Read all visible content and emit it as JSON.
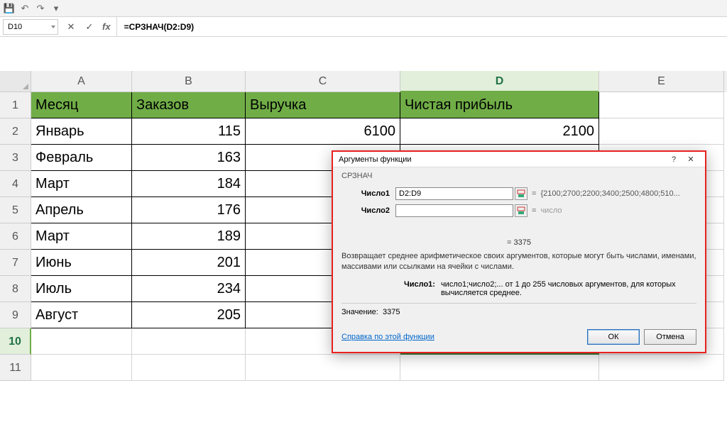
{
  "qat": {
    "save": "💾",
    "undo": "↶",
    "redo": "↷"
  },
  "nameBox": "D10",
  "formulaBar": "=СРЗНАЧ(D2:D9)",
  "columns": [
    "A",
    "B",
    "C",
    "D",
    "E"
  ],
  "rows": [
    "1",
    "2",
    "3",
    "4",
    "5",
    "6",
    "7",
    "8",
    "9",
    "10",
    "11"
  ],
  "headers": {
    "A": "Месяц",
    "B": "Заказов",
    "C": "Выручка",
    "D": "Чистая прибыль"
  },
  "data": [
    {
      "A": "Январь",
      "B": "115",
      "C": "6100",
      "D": "2100"
    },
    {
      "A": "Февраль",
      "B": "163",
      "C": "",
      "D": ""
    },
    {
      "A": "Март",
      "B": "184",
      "C": "",
      "D": ""
    },
    {
      "A": "Апрель",
      "B": "176",
      "C": "",
      "D": ""
    },
    {
      "A": "Март",
      "B": "189",
      "C": "",
      "D": ""
    },
    {
      "A": "Июнь",
      "B": "201",
      "C": "",
      "D": ""
    },
    {
      "A": "Июль",
      "B": "234",
      "C": "",
      "D": ""
    },
    {
      "A": "Август",
      "B": "205",
      "C": "",
      "D": ""
    }
  ],
  "editingCell": {
    "prefix": "=СРЗНАЧ(",
    "arg": "D2:D9",
    "suffix": ")"
  },
  "dialog": {
    "title": "Аргументы функции",
    "fn": "СРЗНАЧ",
    "args": [
      {
        "label": "Число1",
        "value": "D2:D9",
        "preview": "{2100;2700;2200;3400;2500;4800;510..."
      },
      {
        "label": "Число2",
        "value": "",
        "preview": "число"
      }
    ],
    "resultEq": "= 3375",
    "desc": "Возвращает среднее арифметическое своих аргументов, которые могут быть числами, именами, массивами или ссылками на ячейки с числами.",
    "argDescLabel": "Число1:",
    "argDescText": "число1;число2;... от 1 до 255 числовых аргументов, для которых вычисляется среднее.",
    "valueLabel": "Значение:",
    "valueResult": "3375",
    "help": "Справка по этой функции",
    "ok": "ОК",
    "cancel": "Отмена"
  }
}
